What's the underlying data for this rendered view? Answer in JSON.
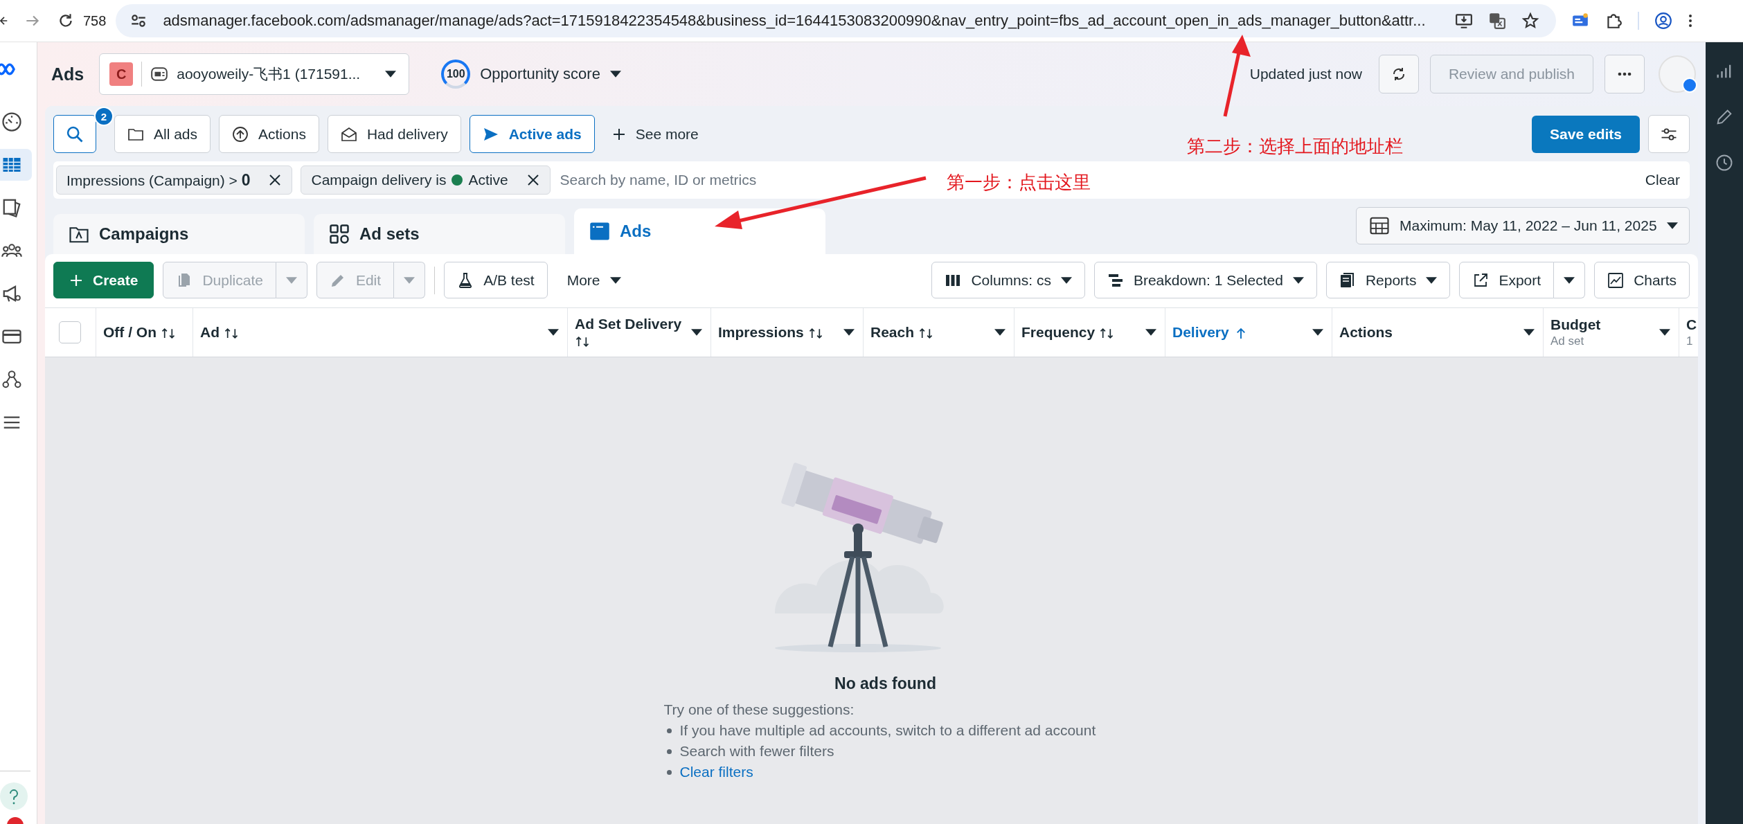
{
  "browser": {
    "tab_count": "758",
    "url": "adsmanager.facebook.com/adsmanager/manage/ads?act=1715918422354548&business_id=1644153083200990&nav_entry_point=fbs_ad_account_open_in_ads_manager_button&attr..."
  },
  "sidebar": {
    "items": [
      {
        "selected": false
      },
      {
        "selected": true
      },
      {
        "selected": false
      },
      {
        "selected": false
      },
      {
        "selected": false
      },
      {
        "selected": false
      },
      {
        "selected": false
      },
      {
        "selected": false
      }
    ]
  },
  "header": {
    "title": "Ads",
    "account_initial": "C",
    "account_name": "aooyoweily-飞书1 (171591...",
    "opportunity_score": "100",
    "opportunity_label": "Opportunity score",
    "updated": "Updated just now",
    "publish": {
      "label": "Review and publish",
      "disabled": true
    }
  },
  "quick_filters": {
    "search_badge": "2",
    "buttons": [
      {
        "label": "All ads",
        "selected": false
      },
      {
        "label": "Actions",
        "selected": false
      },
      {
        "label": "Had delivery",
        "selected": false
      },
      {
        "label": "Active ads",
        "selected": true
      }
    ],
    "see_more": "See more",
    "save_button": "Save edits"
  },
  "filters": {
    "chips": [
      {
        "kind": "text",
        "text": "Impressions (Campaign) > **0**"
      },
      {
        "kind": "status",
        "text": "Campaign delivery is",
        "status": "Active",
        "color": "#1b7f50"
      }
    ],
    "placeholder": "Search by name, ID or metrics",
    "clear": "Clear"
  },
  "level_tabs": [
    {
      "label": "Campaigns",
      "selected": false
    },
    {
      "label": "Ad sets",
      "selected": false
    },
    {
      "label": "Ads",
      "selected": true
    }
  ],
  "date_range": "Maximum: May 11, 2022 – Jun 11, 2025",
  "toolbar": {
    "left": [
      {
        "kind": "primary",
        "label": "Create",
        "disabled": false
      },
      {
        "kind": "split",
        "label": "Duplicate",
        "disabled": true
      },
      {
        "kind": "split",
        "label": "Edit",
        "disabled": true
      },
      {
        "kind": "plain",
        "label": "A/B test",
        "disabled": false
      },
      {
        "kind": "menu",
        "label": "More",
        "disabled": false
      }
    ],
    "right": [
      {
        "kind": "menu",
        "label": "Columns: cs"
      },
      {
        "kind": "menu",
        "label": "Breakdown: 1 Selected"
      },
      {
        "kind": "menu",
        "label": "Reports"
      },
      {
        "kind": "split",
        "label": "Export"
      },
      {
        "kind": "plain",
        "label": "Charts"
      }
    ]
  },
  "table": {
    "select_all_checked": false,
    "columns": [
      {
        "label": "Off / On",
        "sortable": true,
        "sorted": false,
        "menu": false
      },
      {
        "label": "Ad",
        "sortable": true,
        "sorted": false,
        "menu": true
      },
      {
        "label": "Ad Set Delivery",
        "sortable": true,
        "sorted": false,
        "menu": true
      },
      {
        "label": "Impressions",
        "sortable": true,
        "sorted": false,
        "menu": true
      },
      {
        "label": "Reach",
        "sortable": true,
        "sorted": false,
        "menu": true
      },
      {
        "label": "Frequency",
        "sortable": true,
        "sorted": false,
        "menu": true
      },
      {
        "label": "Delivery",
        "sortable": true,
        "sorted": true,
        "menu": true
      },
      {
        "label": "Actions",
        "sortable": false,
        "sorted": false,
        "menu": true
      },
      {
        "label": "Budget",
        "subtitle": "Ad set",
        "sortable": false,
        "sorted": false,
        "menu": true
      },
      {
        "label": "C",
        "subtitle": "1",
        "sortable": false,
        "sorted": false,
        "menu": false
      }
    ]
  },
  "empty_state": {
    "title": "No ads found",
    "intro": "Try one of these suggestions:",
    "suggestions": [
      {
        "kind": "text",
        "text": "If you have multiple ad accounts, switch to a different ad account"
      },
      {
        "kind": "text",
        "text": "Search with fewer filters"
      },
      {
        "kind": "link",
        "text": "Clear filters"
      }
    ]
  },
  "annotations": [
    {
      "text": "第一步：点击这里"
    },
    {
      "text": "第二步：选择上面的地址栏"
    }
  ]
}
